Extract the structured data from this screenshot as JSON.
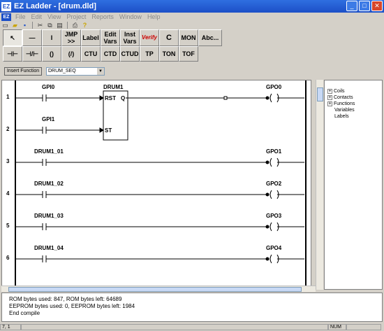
{
  "window": {
    "title": "EZ Ladder - [drum.dld]",
    "logo": "EZ"
  },
  "menu": [
    "File",
    "Edit",
    "View",
    "Project",
    "Reports",
    "Window",
    "Help"
  ],
  "toolbar_row1": [
    {
      "name": "select-arrow-button",
      "label": "↖"
    },
    {
      "name": "horizontal-wire-button",
      "label": "—"
    },
    {
      "name": "vertical-wire-button",
      "label": "I"
    },
    {
      "name": "jump-button",
      "label": "JMP\n>>"
    },
    {
      "name": "label-button",
      "label": "Label"
    },
    {
      "name": "edit-vars-button",
      "label": "Edit\nVars"
    },
    {
      "name": "inst-vars-button",
      "label": "Inst\nVars"
    },
    {
      "name": "verify-button",
      "label": "Verify"
    },
    {
      "name": "compile-button",
      "label": "C"
    },
    {
      "name": "monitor-button",
      "label": "MON"
    },
    {
      "name": "abc-button",
      "label": "Abc..."
    }
  ],
  "toolbar_row2": [
    {
      "name": "contact-no-button",
      "label": "⊣⊢"
    },
    {
      "name": "contact-nc-button",
      "label": "⊣/⊢"
    },
    {
      "name": "coil-button",
      "label": "()"
    },
    {
      "name": "coil-inverted-button",
      "label": "(/)"
    },
    {
      "name": "ctu-button",
      "label": "CTU"
    },
    {
      "name": "ctd-button",
      "label": "CTD"
    },
    {
      "name": "ctud-button",
      "label": "CTUD"
    },
    {
      "name": "tp-button",
      "label": "TP"
    },
    {
      "name": "ton-button",
      "label": "TON"
    },
    {
      "name": "tof-button",
      "label": "TOF"
    }
  ],
  "insert_function": {
    "label": "Insert Function",
    "selected": "DRUM_SEQ"
  },
  "ladder": {
    "rung_numbers": [
      "1",
      "2",
      "3",
      "4",
      "5",
      "6"
    ],
    "contacts": [
      "GPI0",
      "GPI1",
      "DRUM1_01",
      "DRUM1_02",
      "DRUM1_03",
      "DRUM1_04"
    ],
    "coils": [
      "GPO0",
      "GPO1",
      "GPO2",
      "GPO3",
      "GPO4"
    ],
    "block": {
      "name": "DRUM1",
      "pin_rst": "RST",
      "pin_q": "Q",
      "pin_st": "ST"
    }
  },
  "tree": [
    {
      "label": "Coils",
      "expandable": true
    },
    {
      "label": "Contacts",
      "expandable": true
    },
    {
      "label": "Functions",
      "expandable": true
    },
    {
      "label": "Variables",
      "expandable": false
    },
    {
      "label": "Labels",
      "expandable": false
    }
  ],
  "output": [
    "ROM bytes used: 847, ROM bytes left: 64689",
    "EEPROM bytes used: 0, EEPROM bytes left: 1984",
    "End compile"
  ],
  "status": {
    "position": "7, 1",
    "num": "NUM"
  },
  "colors": {
    "title_bar": "#1c4fc7",
    "verify_red": "#cc0000"
  }
}
